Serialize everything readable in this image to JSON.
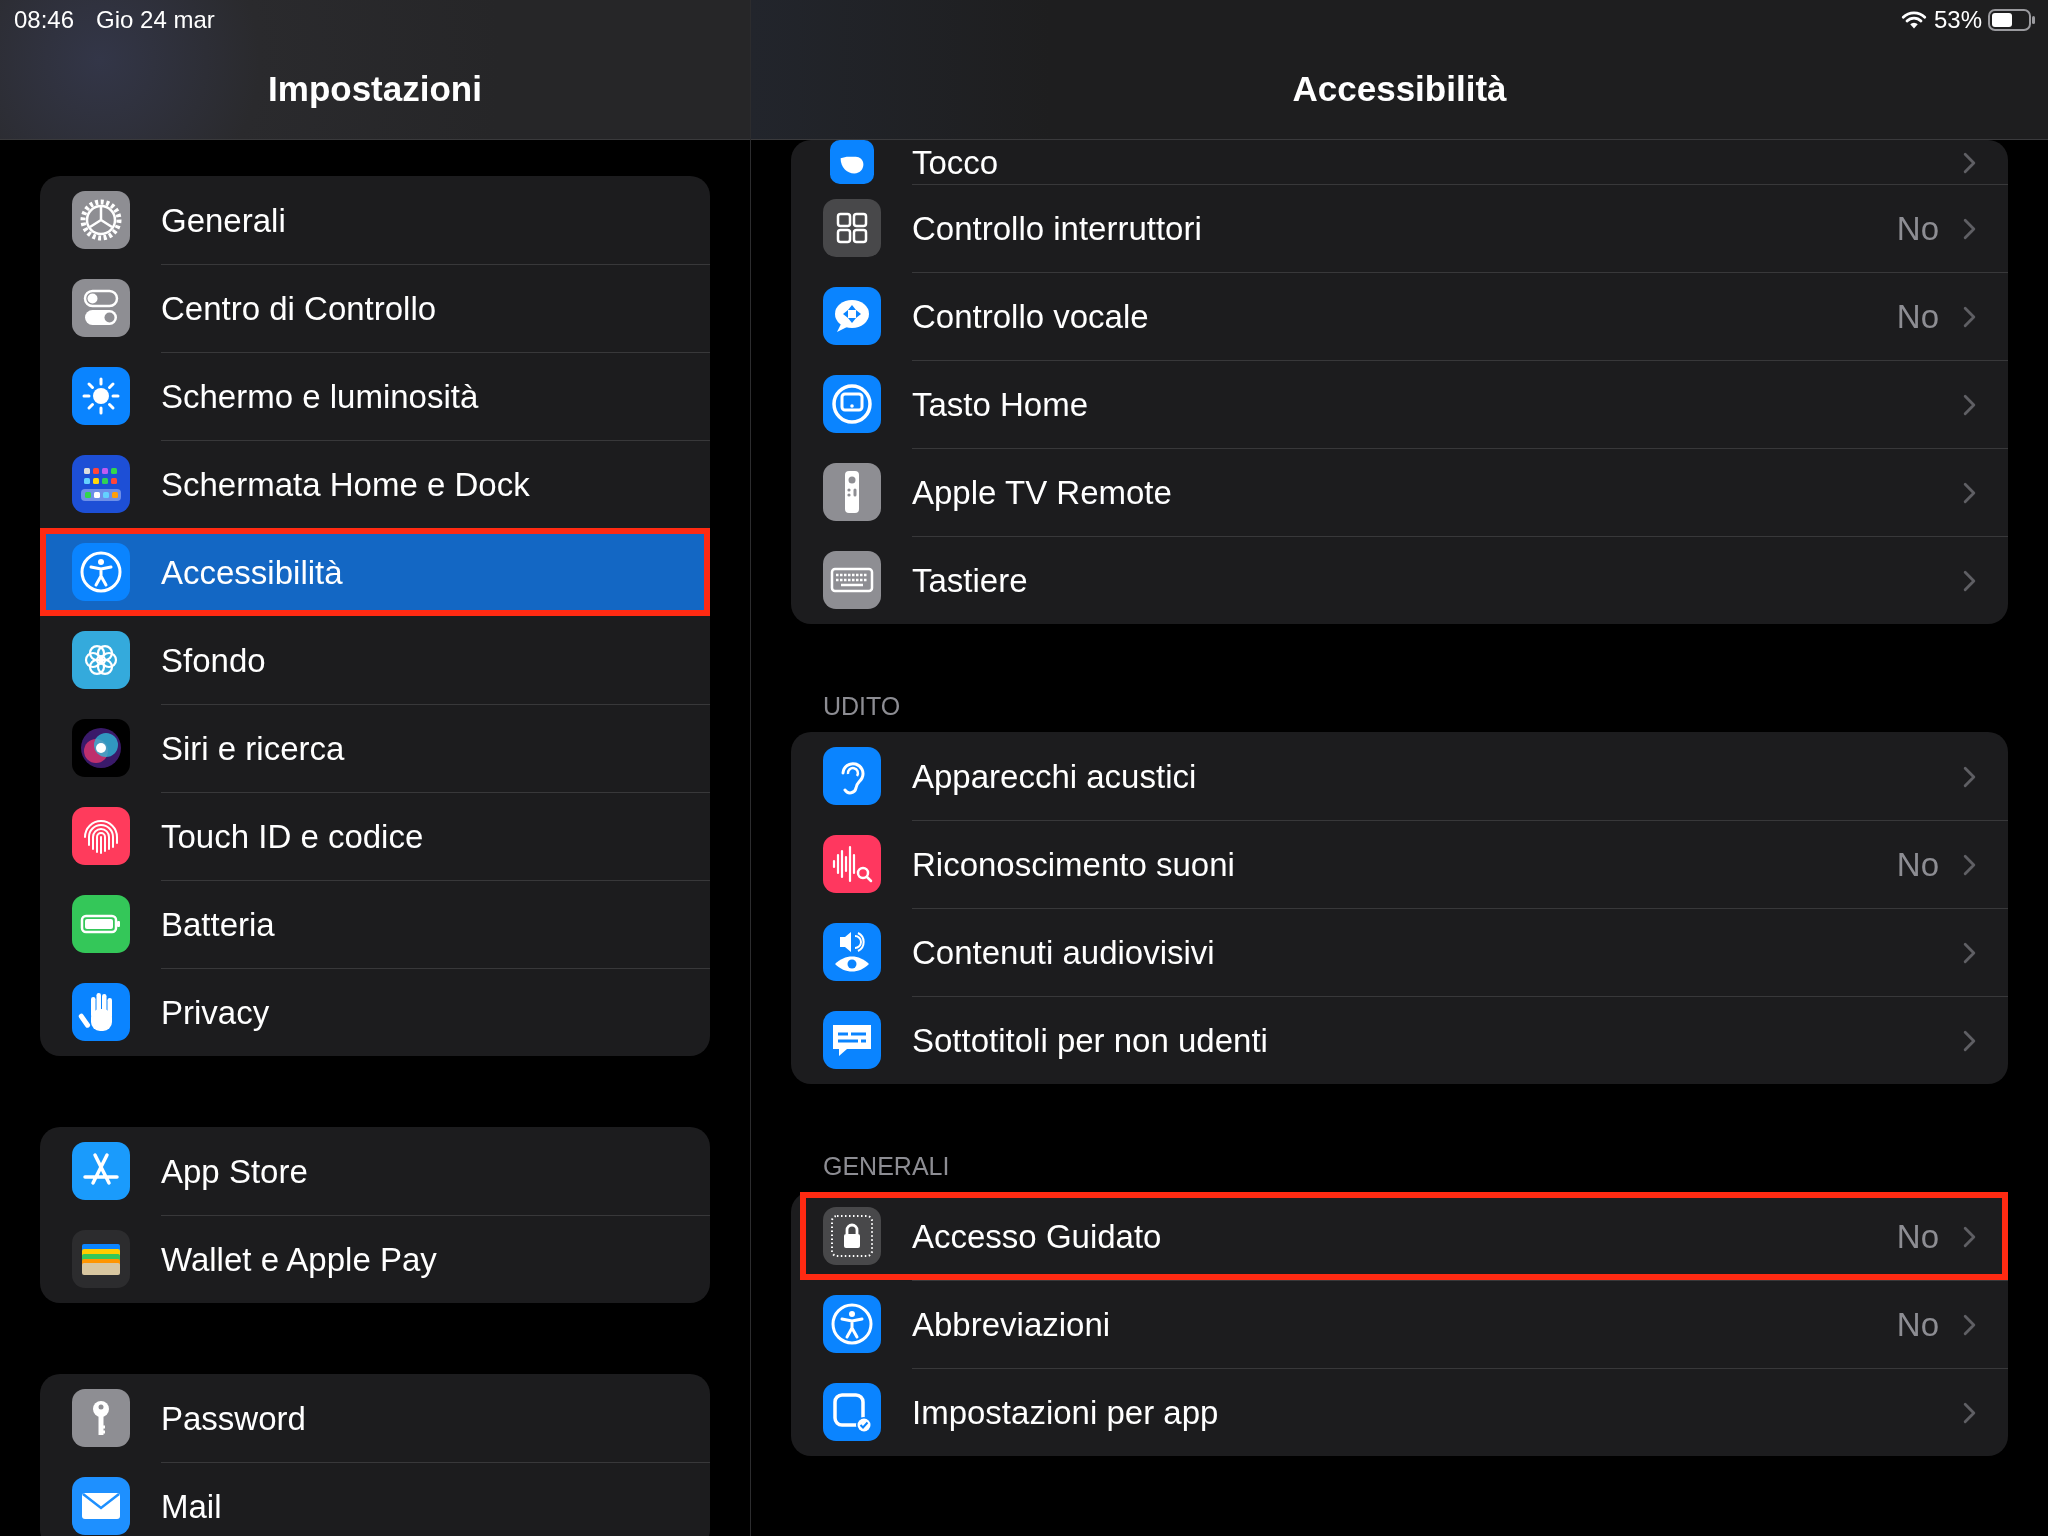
{
  "status_bar": {
    "time": "08:46",
    "date": "Gio 24 mar",
    "battery": "53%"
  },
  "sidebar": {
    "title": "Impostazioni",
    "groups": [
      {
        "items": [
          {
            "label": "Generali",
            "selected": false,
            "highlighted": false
          },
          {
            "label": "Centro di Controllo",
            "selected": false,
            "highlighted": false
          },
          {
            "label": "Schermo e luminosità",
            "selected": false,
            "highlighted": false
          },
          {
            "label": "Schermata Home e Dock",
            "selected": false,
            "highlighted": false
          },
          {
            "label": "Accessibilità",
            "selected": true,
            "highlighted": true
          },
          {
            "label": "Sfondo",
            "selected": false,
            "highlighted": false
          },
          {
            "label": "Siri e ricerca",
            "selected": false,
            "highlighted": false
          },
          {
            "label": "Touch ID e codice",
            "selected": false,
            "highlighted": false
          },
          {
            "label": "Batteria",
            "selected": false,
            "highlighted": false
          },
          {
            "label": "Privacy",
            "selected": false,
            "highlighted": false
          }
        ]
      },
      {
        "items": [
          {
            "label": "App Store",
            "selected": false,
            "highlighted": false
          },
          {
            "label": "Wallet e Apple Pay",
            "selected": false,
            "highlighted": false
          }
        ]
      },
      {
        "items": [
          {
            "label": "Password",
            "selected": false,
            "highlighted": false
          },
          {
            "label": "Mail",
            "selected": false,
            "highlighted": false
          }
        ]
      }
    ]
  },
  "detail": {
    "title": "Accessibilità",
    "sections": [
      {
        "items": [
          {
            "label": "Tocco",
            "highlighted": false
          },
          {
            "label": "Controllo interruttori",
            "value": "No",
            "highlighted": false
          },
          {
            "label": "Controllo vocale",
            "value": "No",
            "highlighted": false
          },
          {
            "label": "Tasto Home",
            "highlighted": false
          },
          {
            "label": "Apple TV Remote",
            "highlighted": false
          },
          {
            "label": "Tastiere",
            "highlighted": false
          }
        ]
      },
      {
        "header": "UDITO",
        "items": [
          {
            "label": "Apparecchi acustici",
            "highlighted": false
          },
          {
            "label": "Riconoscimento suoni",
            "value": "No",
            "highlighted": false
          },
          {
            "label": "Contenuti audiovisivi",
            "highlighted": false
          },
          {
            "label": "Sottotitoli per non udenti",
            "highlighted": false
          }
        ]
      },
      {
        "header": "GENERALI",
        "items": [
          {
            "label": "Accesso Guidato",
            "value": "No",
            "highlighted": true
          },
          {
            "label": "Abbreviazioni",
            "value": "No",
            "highlighted": false
          },
          {
            "label": "Impostazioni per app",
            "highlighted": false
          }
        ]
      }
    ]
  }
}
